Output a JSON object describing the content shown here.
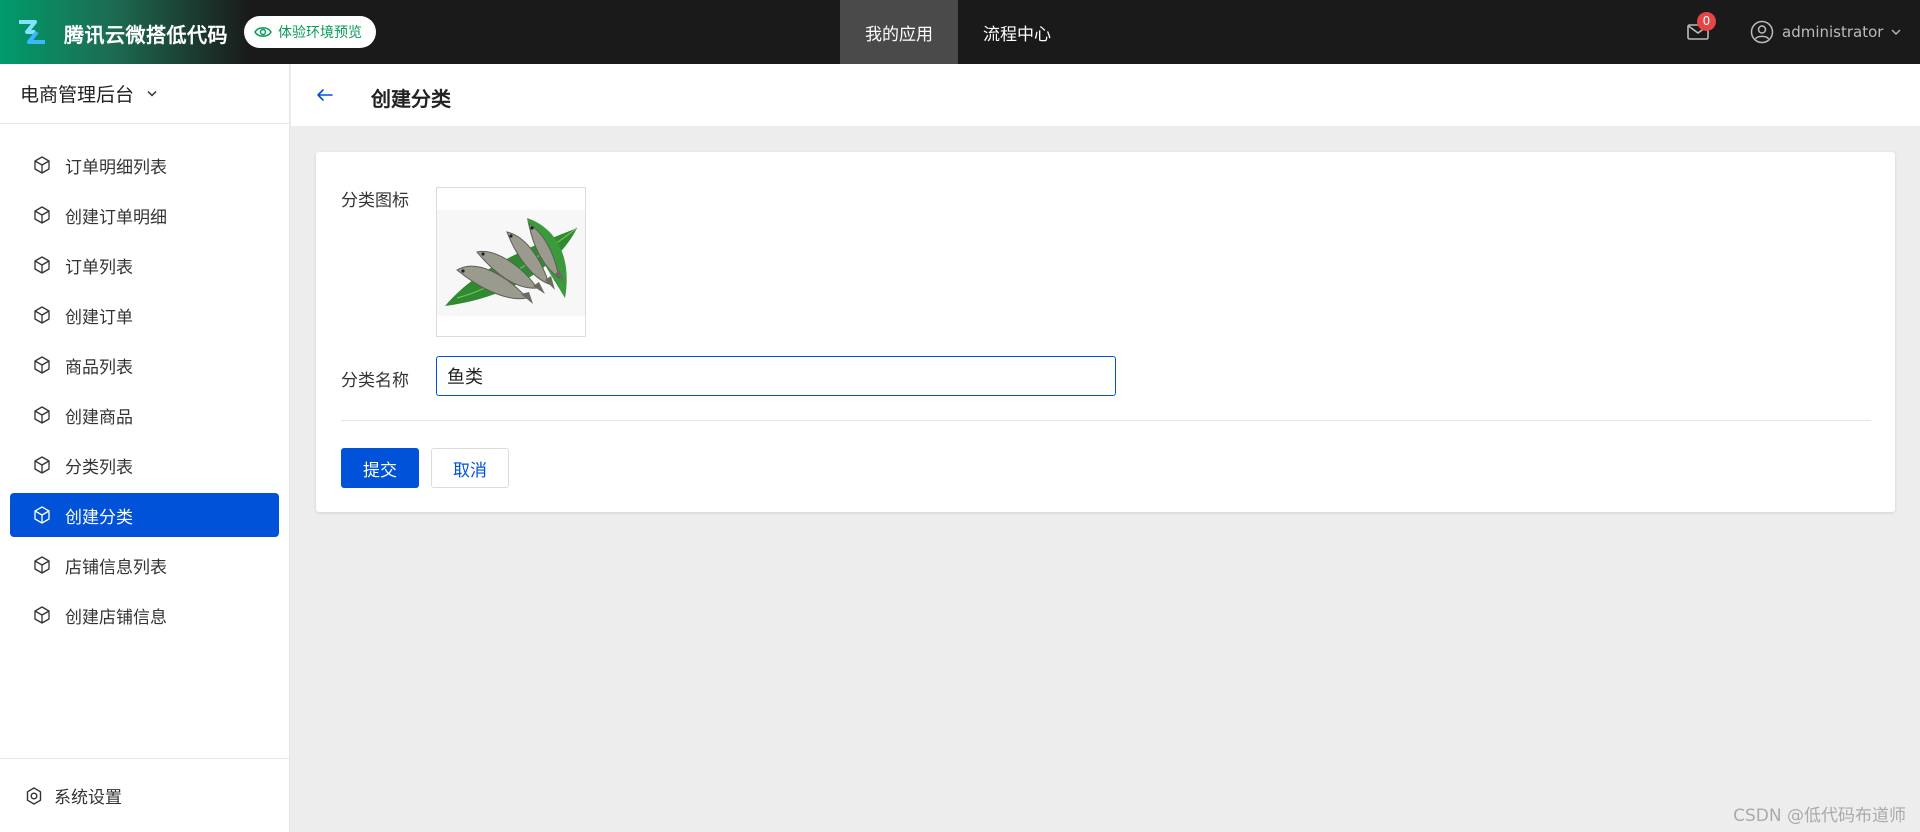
{
  "header": {
    "brand": "腾讯云微搭低代码",
    "preview_label": "体验环境预览",
    "nav": [
      {
        "label": "我的应用",
        "active": true
      },
      {
        "label": "流程中心",
        "active": false
      }
    ],
    "notifications_count": "0",
    "username": "administrator"
  },
  "sidebar": {
    "app_name": "电商管理后台",
    "items": [
      {
        "label": "订单明细列表",
        "active": false
      },
      {
        "label": "创建订单明细",
        "active": false
      },
      {
        "label": "订单列表",
        "active": false
      },
      {
        "label": "创建订单",
        "active": false
      },
      {
        "label": "商品列表",
        "active": false
      },
      {
        "label": "创建商品",
        "active": false
      },
      {
        "label": "分类列表",
        "active": false
      },
      {
        "label": "创建分类",
        "active": true
      },
      {
        "label": "店铺信息列表",
        "active": false
      },
      {
        "label": "创建店铺信息",
        "active": false
      }
    ],
    "settings_label": "系统设置"
  },
  "page": {
    "title": "创建分类"
  },
  "form": {
    "icon_label": "分类图标",
    "name_label": "分类名称",
    "name_value": "鱼类",
    "submit_label": "提交",
    "cancel_label": "取消"
  },
  "watermark": "CSDN @低代码布道师",
  "colors": {
    "primary": "#0052d9",
    "topbar": "#1a1a1a",
    "brand_green": "#009c6b",
    "badge": "#e54545"
  }
}
